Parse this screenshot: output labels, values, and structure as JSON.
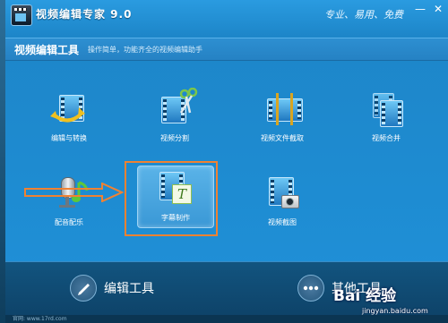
{
  "window": {
    "title": "视频编辑专家 9.0",
    "slogan": "专业、易用、免费",
    "minimize_glyph": "—",
    "close_glyph": "✕"
  },
  "header": {
    "title": "视频编辑工具",
    "subtitle": "操作简单，功能齐全的视频编辑助手"
  },
  "tools": [
    {
      "label": "编辑与转换",
      "icon": "film-arrows-icon"
    },
    {
      "label": "视频分割",
      "icon": "film-scissors-icon"
    },
    {
      "label": "视频文件截取",
      "icon": "film-clip-icon"
    },
    {
      "label": "视频合并",
      "icon": "film-merge-icon"
    },
    {
      "label": "配音配乐",
      "icon": "microphone-note-icon"
    },
    {
      "label": "字幕制作",
      "icon": "film-text-icon"
    },
    {
      "label": "视频截图",
      "icon": "film-camera-icon"
    }
  ],
  "bottom": {
    "left_label": "编辑工具",
    "right_label": "其他工具"
  },
  "status": {
    "text": "官网: www.17rd.com"
  },
  "watermark": {
    "brand": "Bai 经验",
    "url": "jingyan.baidu.com"
  },
  "colors": {
    "annotation": "#f08232",
    "window_blue": "#1d86c9"
  }
}
